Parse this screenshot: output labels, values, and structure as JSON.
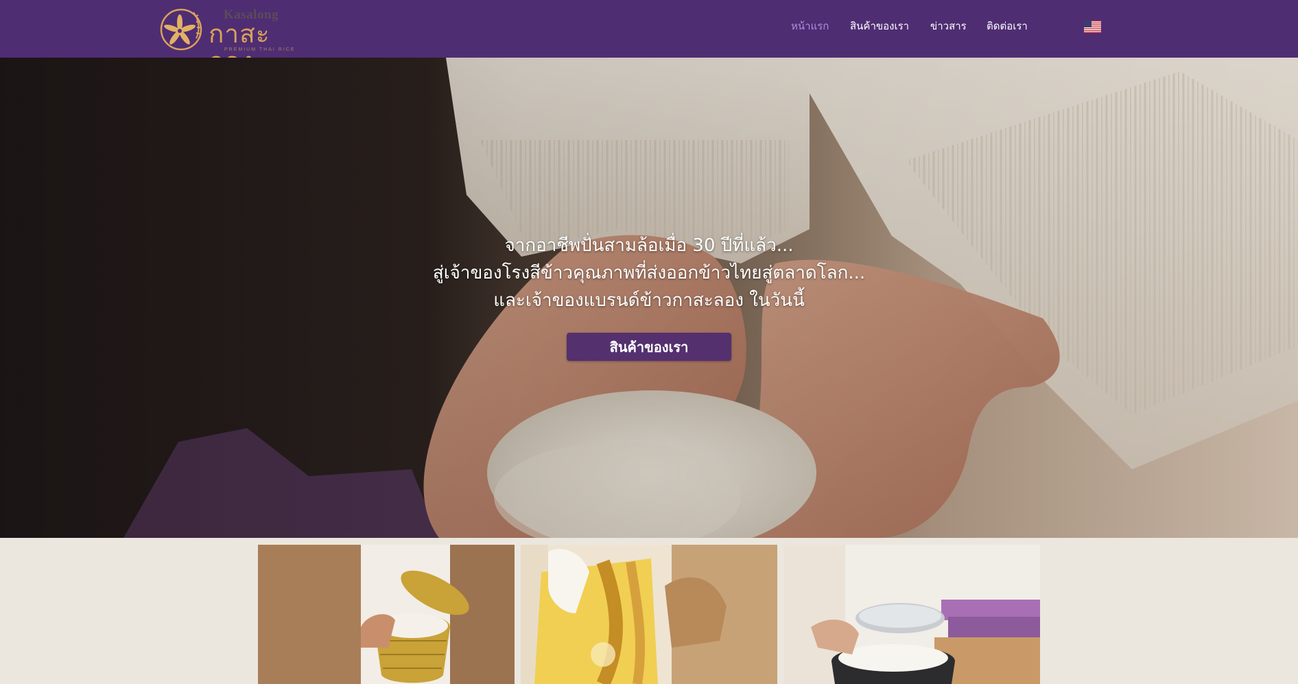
{
  "logo": {
    "brand_en": "Kasalong",
    "brand_th": "กาสะลอง",
    "tagline": "PREMIUM THAI RICE"
  },
  "nav": {
    "items": [
      {
        "label": "หน้าแรก",
        "active": true
      },
      {
        "label": "สินค้าของเรา",
        "active": false
      },
      {
        "label": "ข่าวสาร",
        "active": false
      },
      {
        "label": "ติดต่อเรา",
        "active": false
      }
    ],
    "language_icon": "us-flag-icon"
  },
  "hero": {
    "lines": [
      "จากอาชีพปั่นสามล้อเมื่อ 30 ปีที่แล้ว...",
      "สู่เจ้าของโรงสีข้าวคุณภาพที่ส่งออกข้าวไทยสู่ตลาดโลก...",
      "และเจ้าของแบรนด์ข้าวกาสะลอง ในวันนี้"
    ],
    "button_label": "สินค้าของเรา"
  },
  "colors": {
    "header_bg": "#4f2d73",
    "nav_active": "#b48be0",
    "button_bg": "#54306f",
    "brand_gold": "#d9a25b",
    "section_bg": "#ebe7df"
  }
}
